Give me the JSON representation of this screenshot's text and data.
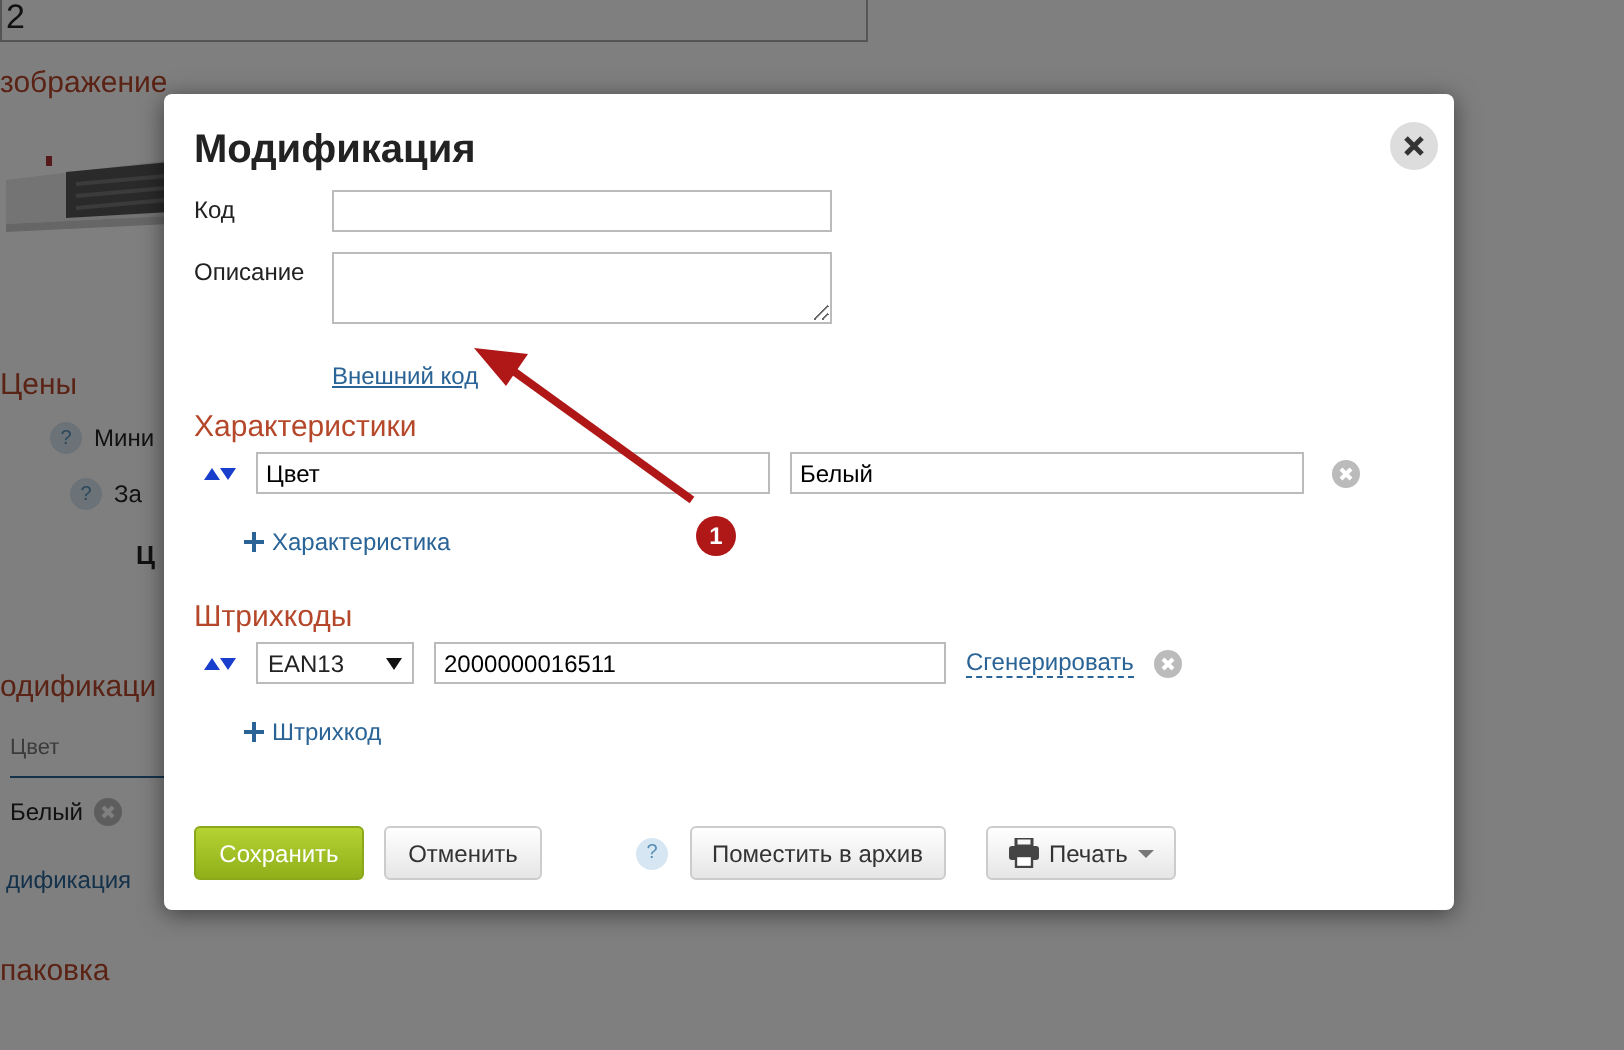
{
  "background_page": {
    "top_field_value": "2",
    "image_heading": "зображение",
    "image": {
      "kind": "picture"
    },
    "prices_heading": "Цены",
    "price_rows": [
      {
        "help_icon": "?",
        "label": "Мини"
      },
      {
        "help_icon": "?",
        "label": "За"
      }
    ],
    "price_sublabels": [
      "Ц"
    ],
    "modifications_heading": "одификаци",
    "modifications_column": "Цвет",
    "modifications_cell": "Белый",
    "modification_link": "дификация",
    "packaging_heading": "паковка"
  },
  "dialog": {
    "title": "Модификация",
    "fields": [
      {
        "label": "Код",
        "kind": "input"
      },
      {
        "label": "Описание",
        "kind": "textarea"
      }
    ],
    "external_code_link": "Внешний код",
    "characteristics": {
      "heading": "Характеристики",
      "rows": [
        {
          "name": "Цвет",
          "value": "Белый"
        }
      ],
      "add_link": "Характеристика"
    },
    "barcodes": {
      "heading": "Штрихкоды",
      "rows": [
        {
          "type": "EAN13",
          "value": "2000000016511",
          "generate_link": "Сгенерировать"
        }
      ],
      "add_link": "Штрихкод"
    },
    "buttons": [
      {
        "label": "Сохранить",
        "kind": "primary"
      },
      {
        "label": "Отменить",
        "kind": "default"
      },
      {
        "label": "Поместить в архив",
        "kind": "help",
        "help_icon": "?"
      },
      {
        "label": "Печать",
        "kind": "print"
      }
    ]
  },
  "annotation": {
    "number": "1"
  }
}
